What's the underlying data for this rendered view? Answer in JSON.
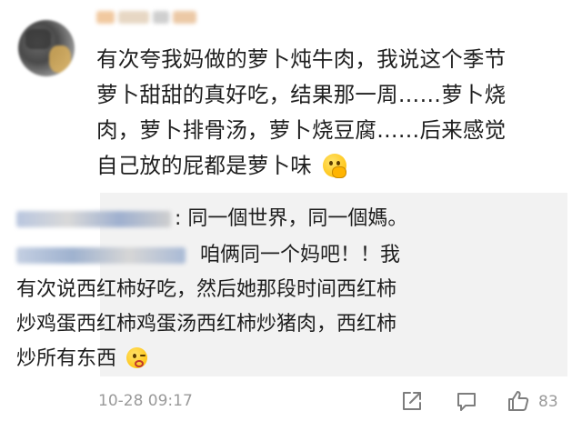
{
  "comment": {
    "lines": [
      "有次夸我妈做的萝卜炖牛肉，我说这个季节",
      "萝卜甜甜的真好吃，结果那一周……萝卜烧",
      "肉，萝卜排骨汤，萝卜烧豆腐……后来感觉",
      "自己放的屁都是萝卜味"
    ],
    "emoji": "shy-thinking-emoji"
  },
  "replies": [
    {
      "text": ": 同一個世界，同一個媽。"
    },
    {
      "lines": [
        "咱俩同一个妈吧！！我",
        "有次说西红柿好吃，然后她那段时间西红柿",
        "炒鸡蛋西红柿鸡蛋汤西红柿炒猪肉，西红柿",
        "炒所有东西"
      ],
      "emoji": "wink-kiss-emoji"
    }
  ],
  "footer": {
    "timestamp": "10-28 09:17",
    "like_count": "83",
    "icons": [
      "share-icon",
      "comment-icon",
      "like-icon"
    ]
  },
  "colors": {
    "text": "#1e1e1e",
    "muted": "#9a9a9a",
    "reply_bg": "#f2f2f2"
  }
}
